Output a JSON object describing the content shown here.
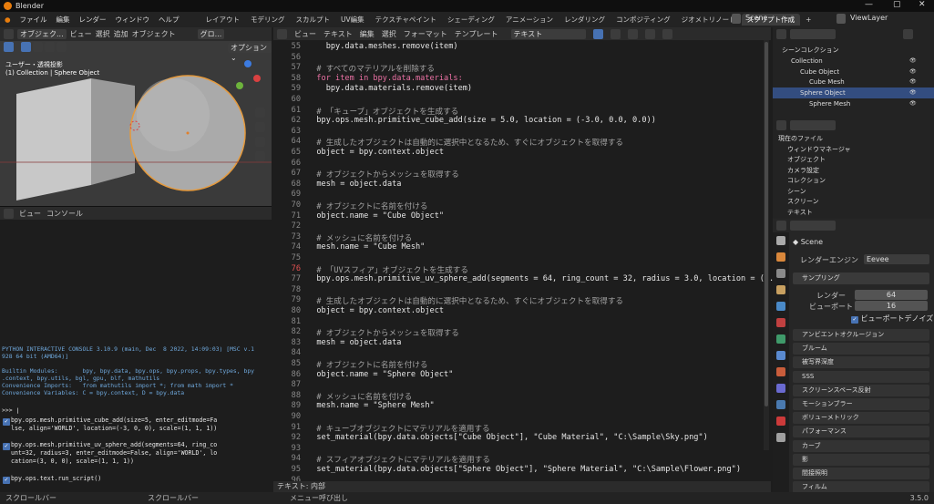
{
  "window": {
    "title": "Blender",
    "min": "—",
    "max": "▢",
    "close": "✕"
  },
  "menus": [
    "ファイル",
    "編集",
    "レンダー",
    "ウィンドウ",
    "ヘルプ"
  ],
  "workspaces": [
    "レイアウト",
    "モデリング",
    "スカルプト",
    "UV編集",
    "テクスチャペイント",
    "シェーディング",
    "アニメーション",
    "レンダリング",
    "コンポジティング",
    "ジオメトリノード",
    "スクリプト作成"
  ],
  "active_workspace": 10,
  "scene": {
    "label": "Scene",
    "viewlayer": "ViewLayer"
  },
  "viewport": {
    "mode": "オブジェク...",
    "menu": [
      "ビュー",
      "選択",
      "追加",
      "オブジェクト"
    ],
    "orient": "グロ...",
    "options": "オプション ⌄",
    "title": "ユーザー・透視投影",
    "subtitle": "(1) Collection | Sphere Object"
  },
  "console": {
    "menu": [
      "ビュー",
      "コンソール"
    ],
    "banner": [
      "PYTHON INTERACTIVE CONSOLE 3.10.9 (main, Dec  8 2022, 14:09:03) [MSC v.1",
      "928 64 bit (AMD64)]",
      "",
      "Builtin Modules:       bpy, bpy.data, bpy.ops, bpy.props, bpy.types, bpy",
      ".context, bpy.utils, bgl, gpu, blf, mathutils",
      "Convenience Imports:   from mathutils import *; from math import *",
      "Convenience Variables: C = bpy.context, D = bpy.data"
    ],
    "prompt": ">>> ",
    "history": [
      "bpy.ops.mesh.primitive_cube_add(size=5, enter_editmode=Fa\nlse, align='WORLD', location=(-3, 0, 0), scale=(1, 1, 1))",
      "bpy.ops.mesh.primitive_uv_sphere_add(segments=64, ring_co\nunt=32, radius=3, enter_editmode=False, align='WORLD', lo\ncation=(3, 0, 0), scale=(1, 1, 1))",
      "bpy.ops.text.run_script()"
    ]
  },
  "editor": {
    "menu": [
      "ビュー",
      "テキスト",
      "編集",
      "選択",
      "フォーマット",
      "テンプレート"
    ],
    "datablock": "テキスト",
    "footer": "テキスト: 内部",
    "lines": [
      {
        "n": "55",
        "t": "    bpy.data.meshes.remove(item)",
        "c": ""
      },
      {
        "n": "56",
        "t": "",
        "c": ""
      },
      {
        "n": "57",
        "t": "  # すべてのマテリアルを削除する",
        "c": "cm"
      },
      {
        "n": "58",
        "t": "  for item in bpy.data.materials:",
        "c": "kw"
      },
      {
        "n": "59",
        "t": "    bpy.data.materials.remove(item)",
        "c": ""
      },
      {
        "n": "60",
        "t": "",
        "c": ""
      },
      {
        "n": "61",
        "t": "  # 「キューブ」オブジェクトを生成する",
        "c": "cm"
      },
      {
        "n": "62",
        "t": "  bpy.ops.mesh.primitive_cube_add(size = 5.0, location = (-3.0, 0.0, 0.0))",
        "c": ""
      },
      {
        "n": "63",
        "t": "",
        "c": ""
      },
      {
        "n": "64",
        "t": "  # 生成したオブジェクトは自動的に選択中となるため、すぐにオブジェクトを取得する",
        "c": "cm"
      },
      {
        "n": "65",
        "t": "  object = bpy.context.object",
        "c": ""
      },
      {
        "n": "66",
        "t": "",
        "c": ""
      },
      {
        "n": "67",
        "t": "  # オブジェクトからメッシュを取得する",
        "c": "cm"
      },
      {
        "n": "68",
        "t": "  mesh = object.data",
        "c": ""
      },
      {
        "n": "69",
        "t": "",
        "c": ""
      },
      {
        "n": "70",
        "t": "  # オブジェクトに名前を付ける",
        "c": "cm"
      },
      {
        "n": "71",
        "t": "  object.name = \"Cube Object\"",
        "c": ""
      },
      {
        "n": "72",
        "t": "",
        "c": ""
      },
      {
        "n": "73",
        "t": "  # メッシュに名前を付ける",
        "c": "cm"
      },
      {
        "n": "74",
        "t": "  mesh.name = \"Cube Mesh\"",
        "c": ""
      },
      {
        "n": "75",
        "t": "",
        "c": ""
      },
      {
        "n": "76",
        "t": "  # 「UVスフィア」オブジェクトを生成する",
        "c": "cm"
      },
      {
        "n": "77",
        "t": "  bpy.ops.mesh.primitive_uv_sphere_add(segments = 64, ring_count = 32, radius = 3.0, location = (3.",
        "c": ""
      },
      {
        "n": "78",
        "t": "",
        "c": ""
      },
      {
        "n": "79",
        "t": "  # 生成したオブジェクトは自動的に選択中となるため、すぐにオブジェクトを取得する",
        "c": "cm"
      },
      {
        "n": "80",
        "t": "  object = bpy.context.object",
        "c": ""
      },
      {
        "n": "81",
        "t": "",
        "c": ""
      },
      {
        "n": "82",
        "t": "  # オブジェクトからメッシュを取得する",
        "c": "cm"
      },
      {
        "n": "83",
        "t": "  mesh = object.data",
        "c": ""
      },
      {
        "n": "84",
        "t": "",
        "c": ""
      },
      {
        "n": "85",
        "t": "  # オブジェクトに名前を付ける",
        "c": "cm"
      },
      {
        "n": "86",
        "t": "  object.name = \"Sphere Object\"",
        "c": ""
      },
      {
        "n": "87",
        "t": "",
        "c": ""
      },
      {
        "n": "88",
        "t": "  # メッシュに名前を付ける",
        "c": "cm"
      },
      {
        "n": "89",
        "t": "  mesh.name = \"Sphere Mesh\"",
        "c": ""
      },
      {
        "n": "90",
        "t": "",
        "c": ""
      },
      {
        "n": "91",
        "t": "  # キューブオブジェクトにマテリアルを適用する",
        "c": "cm"
      },
      {
        "n": "92",
        "t": "  set_material(bpy.data.objects[\"Cube Object\"], \"Cube Material\", \"C:\\Sample\\Sky.png\")",
        "c": ""
      },
      {
        "n": "93",
        "t": "",
        "c": ""
      },
      {
        "n": "94",
        "t": "  # スフィアオブジェクトにマテリアルを適用する",
        "c": "cm"
      },
      {
        "n": "95",
        "t": "  set_material(bpy.data.objects[\"Sphere Object\"], \"Sphere Material\", \"C:\\Sample\\Flower.png\")",
        "c": ""
      },
      {
        "n": "96",
        "t": "",
        "c": ""
      }
    ],
    "current_line": "76"
  },
  "outliner": {
    "rows": [
      {
        "label": "シーンコレクション",
        "indent": 0,
        "sel": false
      },
      {
        "label": "Collection",
        "indent": 1,
        "sel": false
      },
      {
        "label": "Cube Object",
        "indent": 2,
        "sel": false
      },
      {
        "label": "Cube Mesh",
        "indent": 3,
        "sel": false
      },
      {
        "label": "Sphere Object",
        "indent": 2,
        "sel": true
      },
      {
        "label": "Sphere Mesh",
        "indent": 3,
        "sel": false
      }
    ]
  },
  "datablocks": {
    "rows": [
      "現在のファイル",
      "ウィンドウマネージャ",
      "オブジェクト",
      "カメラ設定",
      "コレクション",
      "シーン",
      "スクリーン",
      "テキスト"
    ]
  },
  "properties": {
    "scene": "Scene",
    "render_engine_label": "レンダーエンジン",
    "render_engine": "Eevee",
    "sampling": "サンプリング",
    "render_label": "レンダー",
    "render_value": "64",
    "viewport_label": "ビューポート",
    "viewport_value": "16",
    "denoise": "ビューポートデノイズ",
    "panels": [
      "アンビエントオクルージョン",
      "ブルーム",
      "被写界深度",
      "SSS",
      "スクリーンスペース反射",
      "モーションブラー",
      "ボリューメトリック",
      "パフォーマンス",
      "カーブ",
      "影",
      "間接照明",
      "フィルム"
    ]
  },
  "status": {
    "items": [
      "スクロールバー",
      "スクロールバー",
      "メニュー呼び出し"
    ],
    "version": "3.5.0"
  }
}
